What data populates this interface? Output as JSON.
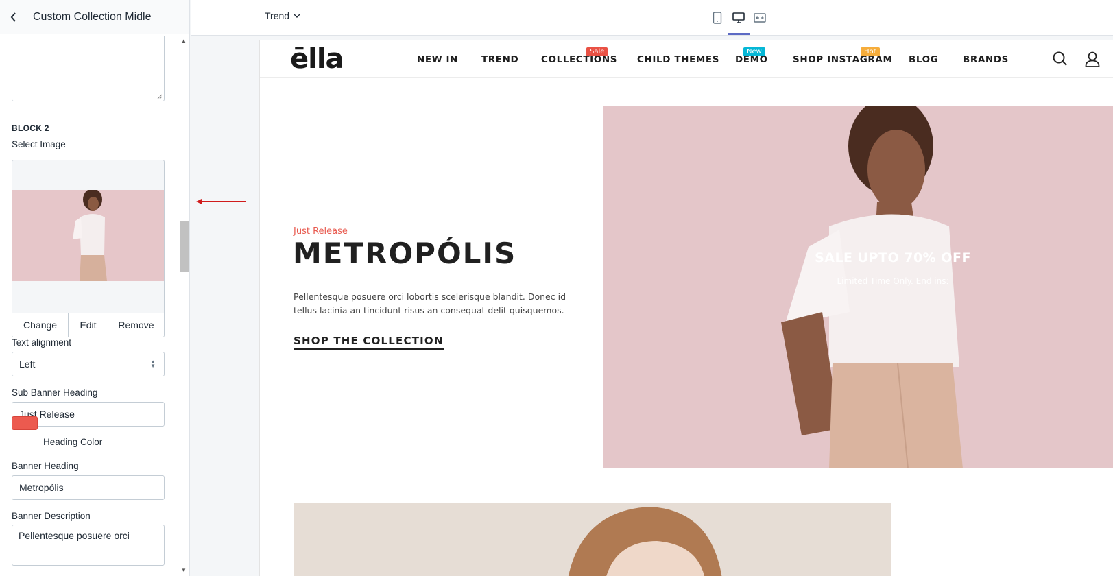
{
  "sidebar": {
    "title": "Custom Collection Midle",
    "block_title": "BLOCK 2",
    "select_image_label": "Select Image",
    "image_actions": {
      "change": "Change",
      "edit": "Edit",
      "remove": "Remove"
    },
    "text_alignment_label": "Text alignment",
    "text_alignment_value": "Left",
    "sub_banner_heading_label": "Sub Banner Heading",
    "sub_banner_heading_value": "Just Release",
    "heading_color_label": "Heading Color",
    "heading_color": "#ec5a4f",
    "banner_heading_label": "Banner Heading",
    "banner_heading_value": "Metropólis",
    "banner_description_label": "Banner Description",
    "banner_description_value": "Pellentesque posuere orci"
  },
  "topbar": {
    "template": "Trend",
    "devices": [
      "mobile-icon",
      "desktop-icon",
      "fullscreen-icon"
    ],
    "active_device": "desktop"
  },
  "preview": {
    "logo": "ēlla",
    "nav": [
      {
        "label": "NEW IN"
      },
      {
        "label": "TREND"
      },
      {
        "label": "COLLECTIONS",
        "badge": "Sale",
        "badge_color": "#e95144"
      },
      {
        "label": "CHILD THEMES"
      },
      {
        "label": "DEMO",
        "badge": "New",
        "badge_color": "#05b7d6"
      },
      {
        "label": "SHOP INSTAGRAM",
        "badge": "Hot",
        "badge_color": "#f6ad3b"
      },
      {
        "label": "BLOG"
      },
      {
        "label": "BRANDS"
      }
    ],
    "hero": {
      "sub_heading": "Just Release",
      "heading": "METROPÓLIS",
      "description": "Pellentesque posuere orci lobortis scelerisque blandit. Donec id tellus lacinia an tincidunt risus an consequat delit quisquemos.",
      "cta": "SHOP THE COLLECTION",
      "image_title": "SALE UPTO 70% OFF",
      "image_subtitle": "Limited Time Only. End ins:"
    }
  }
}
